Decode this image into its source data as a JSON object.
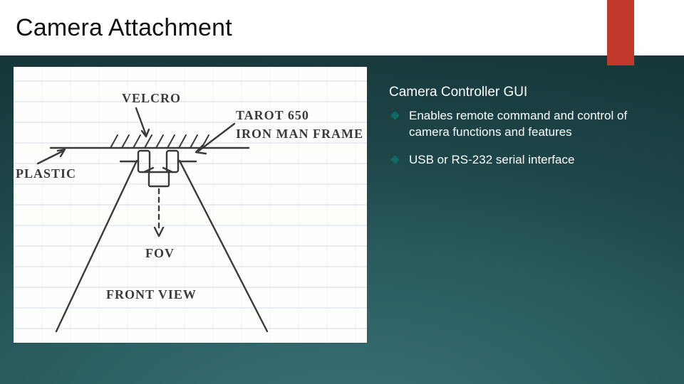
{
  "slide": {
    "title": "Camera Attachment",
    "subhead": "Camera Controller GUI",
    "bullets": [
      "Enables remote command and control of camera functions and features",
      "USB or RS-232 serial interface"
    ]
  },
  "sketch": {
    "labels": {
      "plastic": "PLASTIC",
      "velcro": "VELCRO",
      "frame1": "TAROT 650",
      "frame2": "IRON MAN FRAME",
      "fov": "FOV",
      "front": "FRONT VIEW"
    }
  },
  "colors": {
    "accent": "#c0392b"
  }
}
